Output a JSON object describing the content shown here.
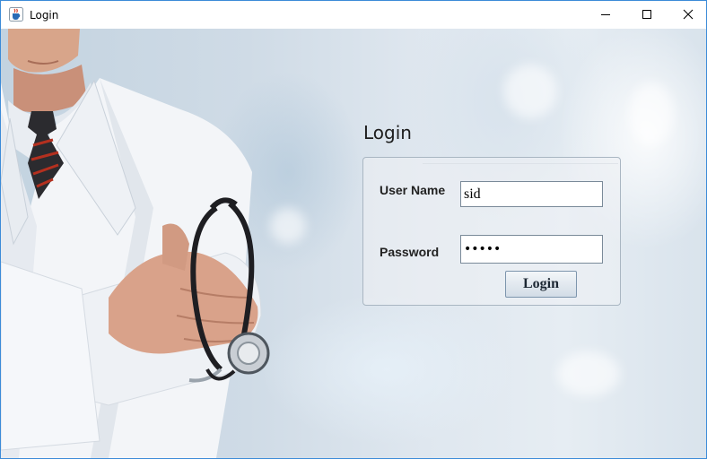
{
  "window": {
    "title": "Login",
    "icon": "java-cup-icon",
    "controls": [
      "minimize-icon",
      "maximize-icon",
      "close-icon"
    ]
  },
  "form": {
    "heading": "Login",
    "username_label": "User Name",
    "username_value": "sid",
    "password_label": "Password",
    "password_value": "sid12",
    "submit_label": "Login"
  },
  "colors": {
    "window_border": "#3c8bd8",
    "button_top": "#f3f6f9",
    "button_bottom": "#d2dce6",
    "panel_border": "#a9b6c2"
  }
}
